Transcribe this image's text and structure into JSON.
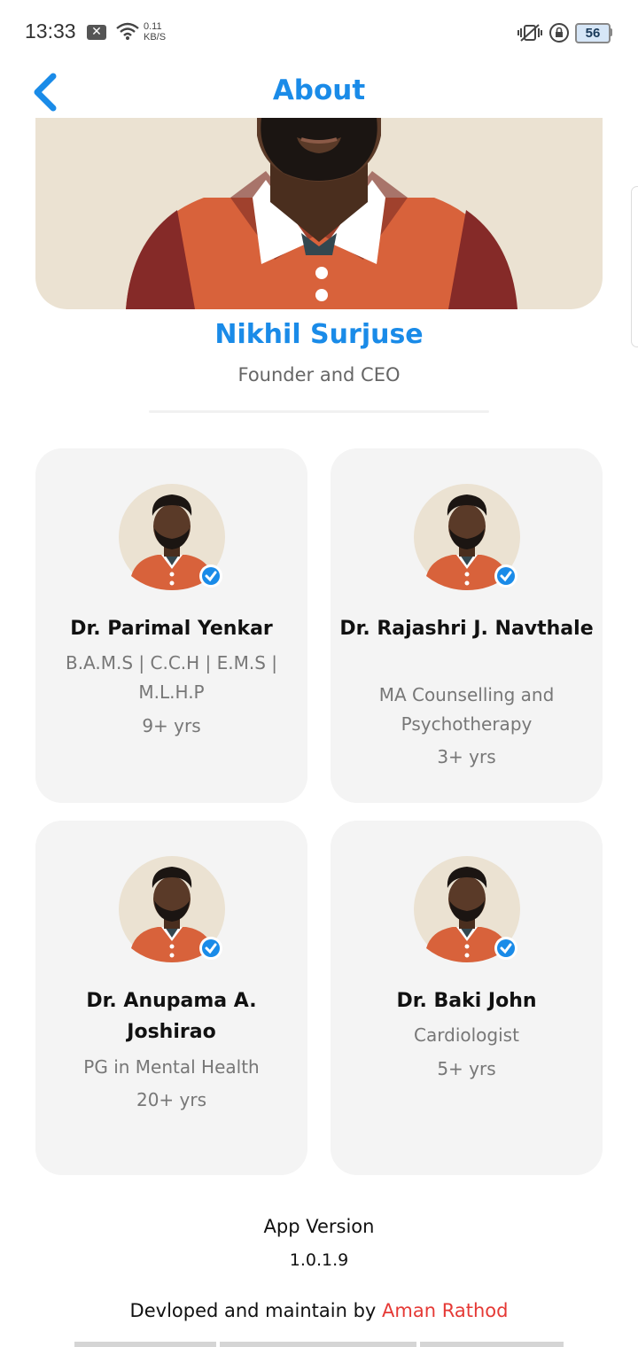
{
  "status_bar": {
    "time": "13:33",
    "notification_icon": "close-box-icon",
    "net_speed_value": "0.11",
    "net_speed_unit": "KB/S",
    "battery": "56"
  },
  "header": {
    "title": "About",
    "back_icon": "chevron-left-icon"
  },
  "founder": {
    "name": "Nikhil Surjuse",
    "role": "Founder and CEO"
  },
  "team": [
    {
      "name": "Dr. Parimal Yenkar",
      "qualification": "B.A.M.S | C.C.H | E.M.S | M.L.H.P",
      "experience": "9+ yrs"
    },
    {
      "name": "Dr. Rajashri J. Navthale",
      "qualification": "MA Counselling and Psychotherapy",
      "experience": "3+ yrs"
    },
    {
      "name": "Dr. Anupama A. Joshirao",
      "qualification": "PG in Mental Health",
      "experience": "20+ yrs"
    },
    {
      "name": "Dr. Baki John",
      "qualification": "Cardiologist",
      "experience": "5+ yrs"
    }
  ],
  "footer": {
    "version_label": "App Version",
    "version_value": "1.0.1.9",
    "developed_prefix": "Devloped and maintain by",
    "developer": "Aman Rathod"
  },
  "colors": {
    "accent": "#1a8be8",
    "developer": "#e53935",
    "card_bg": "#f4f4f4",
    "avatar_bg": "#ebe2d2",
    "shirt": "#d8623b",
    "skin": "#5a3a28"
  }
}
